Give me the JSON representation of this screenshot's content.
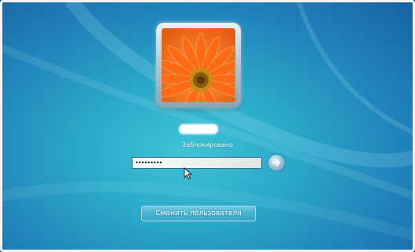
{
  "lock_screen": {
    "user_tile": {
      "picture": "orange-gerbera-flower"
    },
    "username": "",
    "status": "Заблокировано",
    "password": {
      "masked_value": "•••••••••",
      "submit_icon": "arrow-right-icon"
    },
    "switch_user_label": "Сменить пользователя"
  },
  "colors": {
    "background_center": "#3ec4d6",
    "background_edge": "#185fa0",
    "flower": "#ff7a1a",
    "text": "#eef8fb"
  }
}
